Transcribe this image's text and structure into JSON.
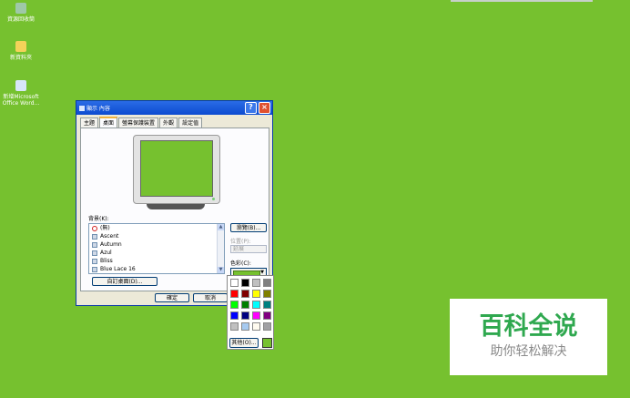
{
  "desktop": {
    "icons": [
      {
        "label": "資源回收筒",
        "color": "#9fc8a8"
      },
      {
        "label": "新資料夾",
        "color": "#f4d25a"
      },
      {
        "label": "新增Microsoft Office Word...",
        "color": "#d8e6f8"
      }
    ]
  },
  "dialog": {
    "title": "顯示 內容",
    "help_glyph": "?",
    "close_glyph": "×",
    "tabs": [
      "主題",
      "桌面",
      "螢幕保護裝置",
      "外觀",
      "設定值"
    ],
    "active_tab": "桌面",
    "background_label": "背景(K):",
    "backgrounds": [
      "(無)",
      "Ascent",
      "Autumn",
      "Azul",
      "Bliss",
      "Blue Lace 16"
    ],
    "browse_button": "瀏覽(B)...",
    "position_label": "位置(P):",
    "position_value": "延展",
    "color_label": "色彩(C):",
    "color_value": "#76c12f",
    "customize_button": "自訂桌面(D)...",
    "ok_button": "確定",
    "cancel_button": "取消"
  },
  "palette": {
    "colors": [
      "#ffffff",
      "#000000",
      "#c0c0c0",
      "#808080",
      "#ff0000",
      "#800000",
      "#ffff00",
      "#808000",
      "#00ff00",
      "#008000",
      "#00ffff",
      "#008080",
      "#0000ff",
      "#000080",
      "#ff00ff",
      "#800080",
      "#c0c0c0",
      "#a6caf0",
      "#fffbf0",
      "#a0a0a4"
    ],
    "other_button": "其他(O)...",
    "current_color": "#76c12f"
  },
  "watermark": {
    "main": "百科全说",
    "sub": "助你轻松解决"
  }
}
